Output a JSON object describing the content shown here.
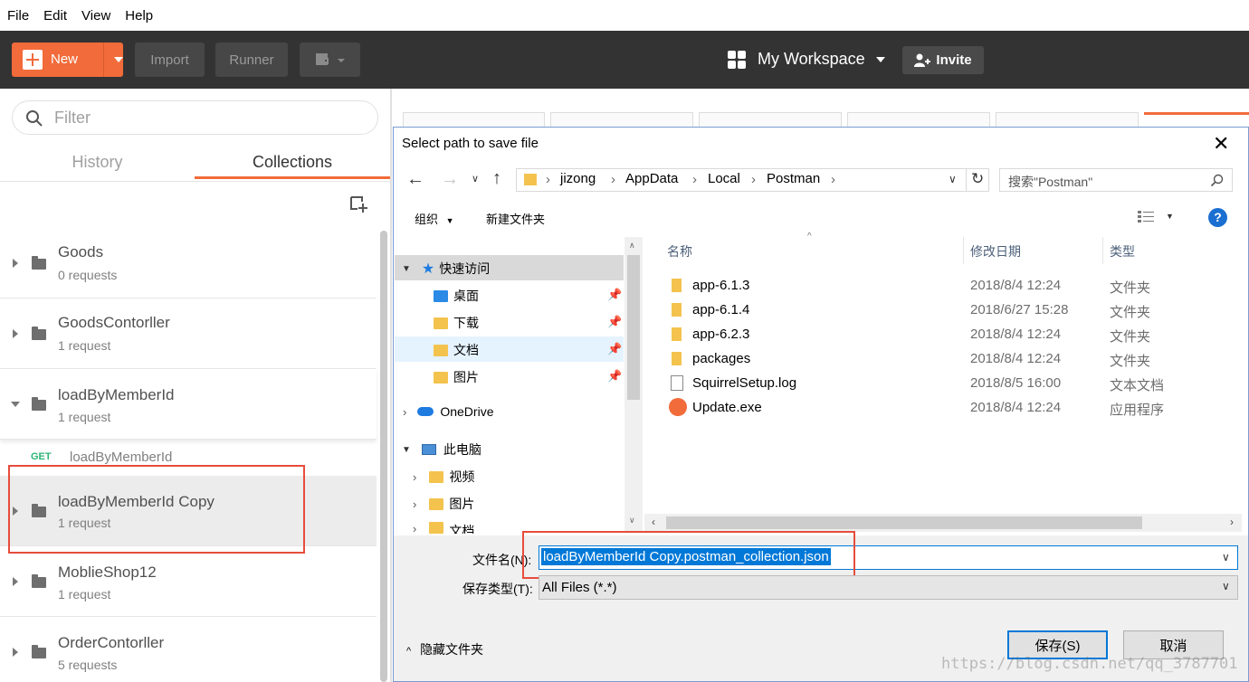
{
  "menu": [
    "File",
    "Edit",
    "View",
    "Help"
  ],
  "toolbar": {
    "new_label": "New",
    "import_label": "Import",
    "runner_label": "Runner",
    "workspace_label": "My Workspace",
    "invite_label": "Invite"
  },
  "sidebar": {
    "filter_placeholder": "Filter",
    "tabs": [
      "History",
      "Collections"
    ],
    "active_tab": "Collections",
    "collections": [
      {
        "name": "Goods",
        "count": "0 requests",
        "expanded": false
      },
      {
        "name": "GoodsContorller",
        "count": "1 request",
        "expanded": false
      },
      {
        "name": "loadByMemberId",
        "count": "1 request",
        "expanded": true,
        "requests": [
          {
            "method": "GET",
            "name": "loadByMemberId"
          }
        ]
      },
      {
        "name": "loadByMemberId Copy",
        "count": "1 request",
        "expanded": false
      },
      {
        "name": "MoblieShop12",
        "count": "1 request",
        "expanded": false
      },
      {
        "name": "OrderContorller",
        "count": "5 requests",
        "expanded": false
      }
    ]
  },
  "dialog": {
    "title": "Select path to save file",
    "breadcrumb": [
      "jizong",
      "AppData",
      "Local",
      "Postman"
    ],
    "search_placeholder": "搜索\"Postman\"",
    "organize_label": "组织",
    "new_folder_label": "新建文件夹",
    "nav": {
      "quick_access": "快速访问",
      "quick_items": [
        "桌面",
        "下载",
        "文档",
        "图片"
      ],
      "onedrive": "OneDrive",
      "this_pc": "此电脑",
      "pc_items": [
        "视频",
        "图片",
        "文档"
      ]
    },
    "columns": [
      "名称",
      "修改日期",
      "类型"
    ],
    "files": [
      {
        "name": "app-6.1.3",
        "date": "2018/8/4 12:24",
        "type": "文件夹",
        "kind": "folder"
      },
      {
        "name": "app-6.1.4",
        "date": "2018/6/27 15:28",
        "type": "文件夹",
        "kind": "folder"
      },
      {
        "name": "app-6.2.3",
        "date": "2018/8/4 12:24",
        "type": "文件夹",
        "kind": "folder"
      },
      {
        "name": "packages",
        "date": "2018/8/4 12:24",
        "type": "文件夹",
        "kind": "folder"
      },
      {
        "name": "SquirrelSetup.log",
        "date": "2018/8/5 16:00",
        "type": "文本文档",
        "kind": "text"
      },
      {
        "name": "Update.exe",
        "date": "2018/8/4 12:24",
        "type": "应用程序",
        "kind": "exe"
      }
    ],
    "filename_label": "文件名(N):",
    "filename_value": "loadByMemberId Copy.postman_collection.json",
    "filetype_label": "保存类型(T):",
    "filetype_value": "All Files (*.*)",
    "hide_folders_label": "隐藏文件夹",
    "save_label": "保存(S)",
    "cancel_label": "取消"
  },
  "watermark": "https://blog.csdn.net/qq_3787701"
}
